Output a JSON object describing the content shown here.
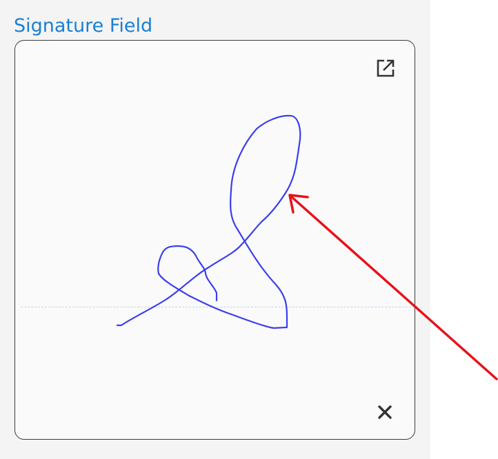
{
  "field": {
    "title": "Signature Field"
  },
  "controls": {
    "expand_icon": "external-link-icon",
    "clear_icon": "close-icon"
  },
  "colors": {
    "title": "#1a7fd4",
    "ink": "#3b3df0",
    "baseline": "#c2d2ec",
    "annotation_arrow": "#e8101a"
  }
}
